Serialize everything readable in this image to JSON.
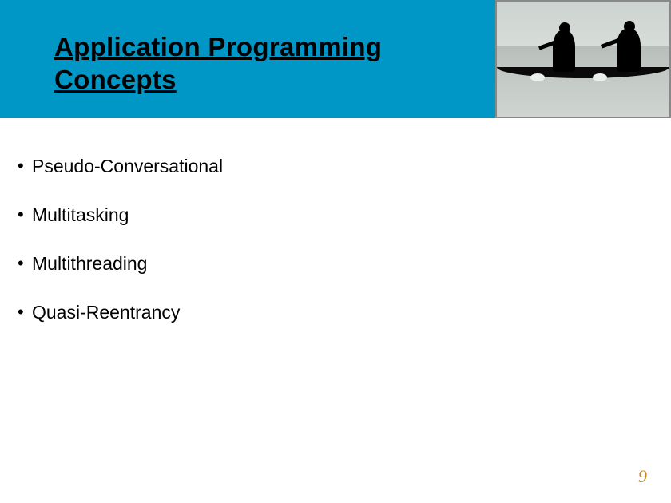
{
  "header": {
    "title": "Application Programming Concepts"
  },
  "bullets": [
    "Pseudo-Conversational",
    "Multitasking",
    "Multithreading",
    "Quasi-Reentrancy"
  ],
  "page_number": "9",
  "colors": {
    "accent": "#0096c6",
    "page_num": "#c08a2a"
  }
}
